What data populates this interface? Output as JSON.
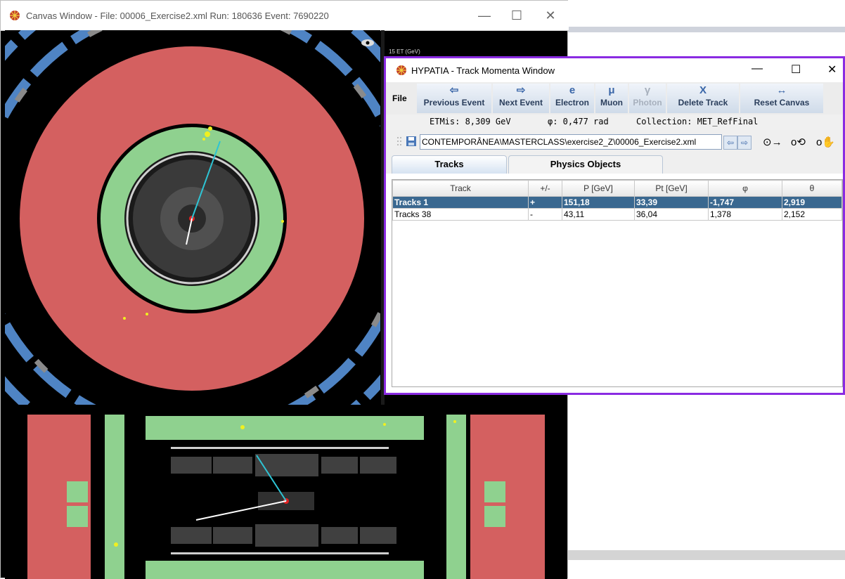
{
  "canvas_window": {
    "title": "Canvas Window - File: 00006_Exercise2.xml  Run: 180636  Event: 7690220",
    "controls": [
      "—",
      "☐",
      "✕"
    ],
    "scale_label": "15 ET (GeV)"
  },
  "track_window": {
    "title": "HYPATIA - Track Momenta Window",
    "controls": [
      "—",
      "☐",
      "✕"
    ],
    "file_menu": "File",
    "toolbar": [
      {
        "label": "Previous Event",
        "icon": "⇦",
        "enabled": true
      },
      {
        "label": "Next Event",
        "icon": "⇨",
        "enabled": true
      },
      {
        "label": "Electron",
        "icon": "e",
        "enabled": true
      },
      {
        "label": "Muon",
        "icon": "μ",
        "enabled": true
      },
      {
        "label": "Photon",
        "icon": "γ",
        "enabled": false
      },
      {
        "label": "Delete Track",
        "icon": "X",
        "enabled": true
      },
      {
        "label": "Reset Canvas",
        "icon": "↔",
        "enabled": true
      }
    ],
    "info": {
      "etmis": "ETMis: 8,309 GeV",
      "phi": "φ: 0,477 rad",
      "collection": "Collection: MET_RefFinal"
    },
    "path": "CONTEMPORÂNEA\\MASTERCLASS\\exercise2_Z\\00006_Exercise2.xml",
    "tabs": [
      "Tracks",
      "Physics Objects"
    ],
    "table": {
      "columns": [
        "Track",
        "+/-",
        "P [GeV]",
        "Pt [GeV]",
        "φ",
        "θ"
      ],
      "rows": [
        [
          "Tracks 1",
          "+",
          "151,18",
          "33,39",
          "-1,747",
          "2,919"
        ],
        [
          "Tracks 38",
          "-",
          "43,11",
          "36,04",
          "1,378",
          "2,152"
        ]
      ]
    }
  }
}
